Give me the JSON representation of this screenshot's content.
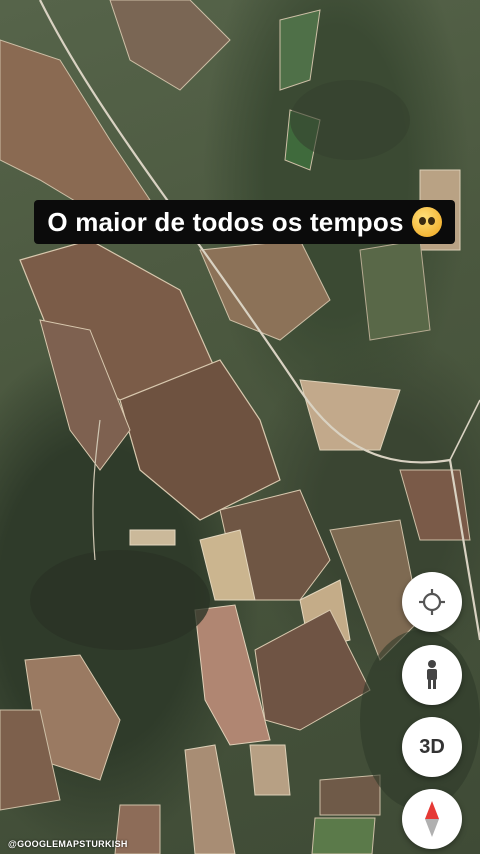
{
  "caption": {
    "text": "O maior de todos os tempos",
    "emoji": "pleading-face"
  },
  "controls": {
    "locate": {
      "icon": "crosshair-icon"
    },
    "street_view": {
      "icon": "pegman-icon"
    },
    "view_3d": {
      "label": "3D"
    },
    "compass": {
      "icon": "compass-icon"
    }
  },
  "watermark": {
    "text": "@GOOGLEMAPSTURKISH"
  }
}
